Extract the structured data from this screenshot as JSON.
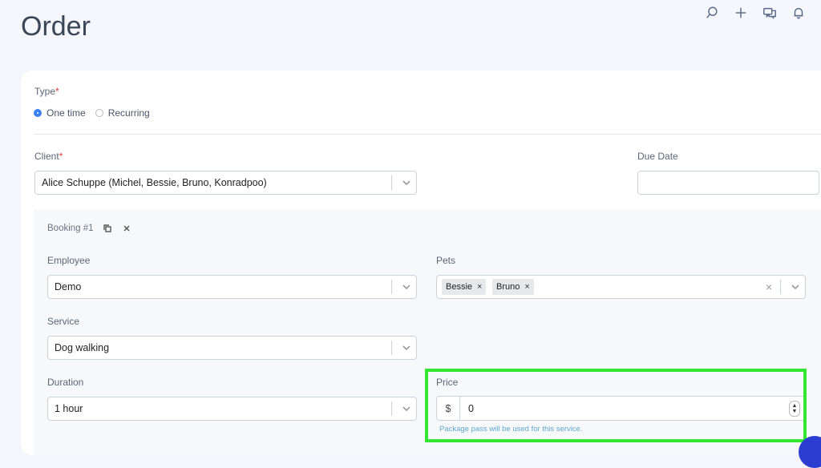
{
  "page": {
    "title": "Order"
  },
  "topbar": {
    "icons": [
      "search-icon",
      "plus-icon",
      "chat-icon",
      "bell-icon"
    ]
  },
  "type": {
    "label": "Type",
    "required_mark": "*",
    "options": [
      {
        "label": "One time",
        "checked": true
      },
      {
        "label": "Recurring",
        "checked": false
      }
    ]
  },
  "client": {
    "label": "Client",
    "required_mark": "*",
    "value": "Alice Schuppe (Michel, Bessie, Bruno, Konradpoo)"
  },
  "due_date": {
    "label": "Due Date",
    "value": ""
  },
  "booking": {
    "title": "Booking #1",
    "employee": {
      "label": "Employee",
      "value": "Demo"
    },
    "pets": {
      "label": "Pets",
      "tags": [
        "Bessie",
        "Bruno"
      ],
      "tag_remove": "×",
      "clear": "×"
    },
    "service": {
      "label": "Service",
      "value": "Dog walking"
    },
    "duration": {
      "label": "Duration",
      "value": "1 hour"
    },
    "price": {
      "label": "Price",
      "currency": "$",
      "value": "0",
      "hint": "Package pass will be used for this service."
    }
  },
  "colors": {
    "accent": "#3b82f6",
    "highlight": "#33e633",
    "hint": "#5fa9cf",
    "fab": "#2c3ed1"
  }
}
